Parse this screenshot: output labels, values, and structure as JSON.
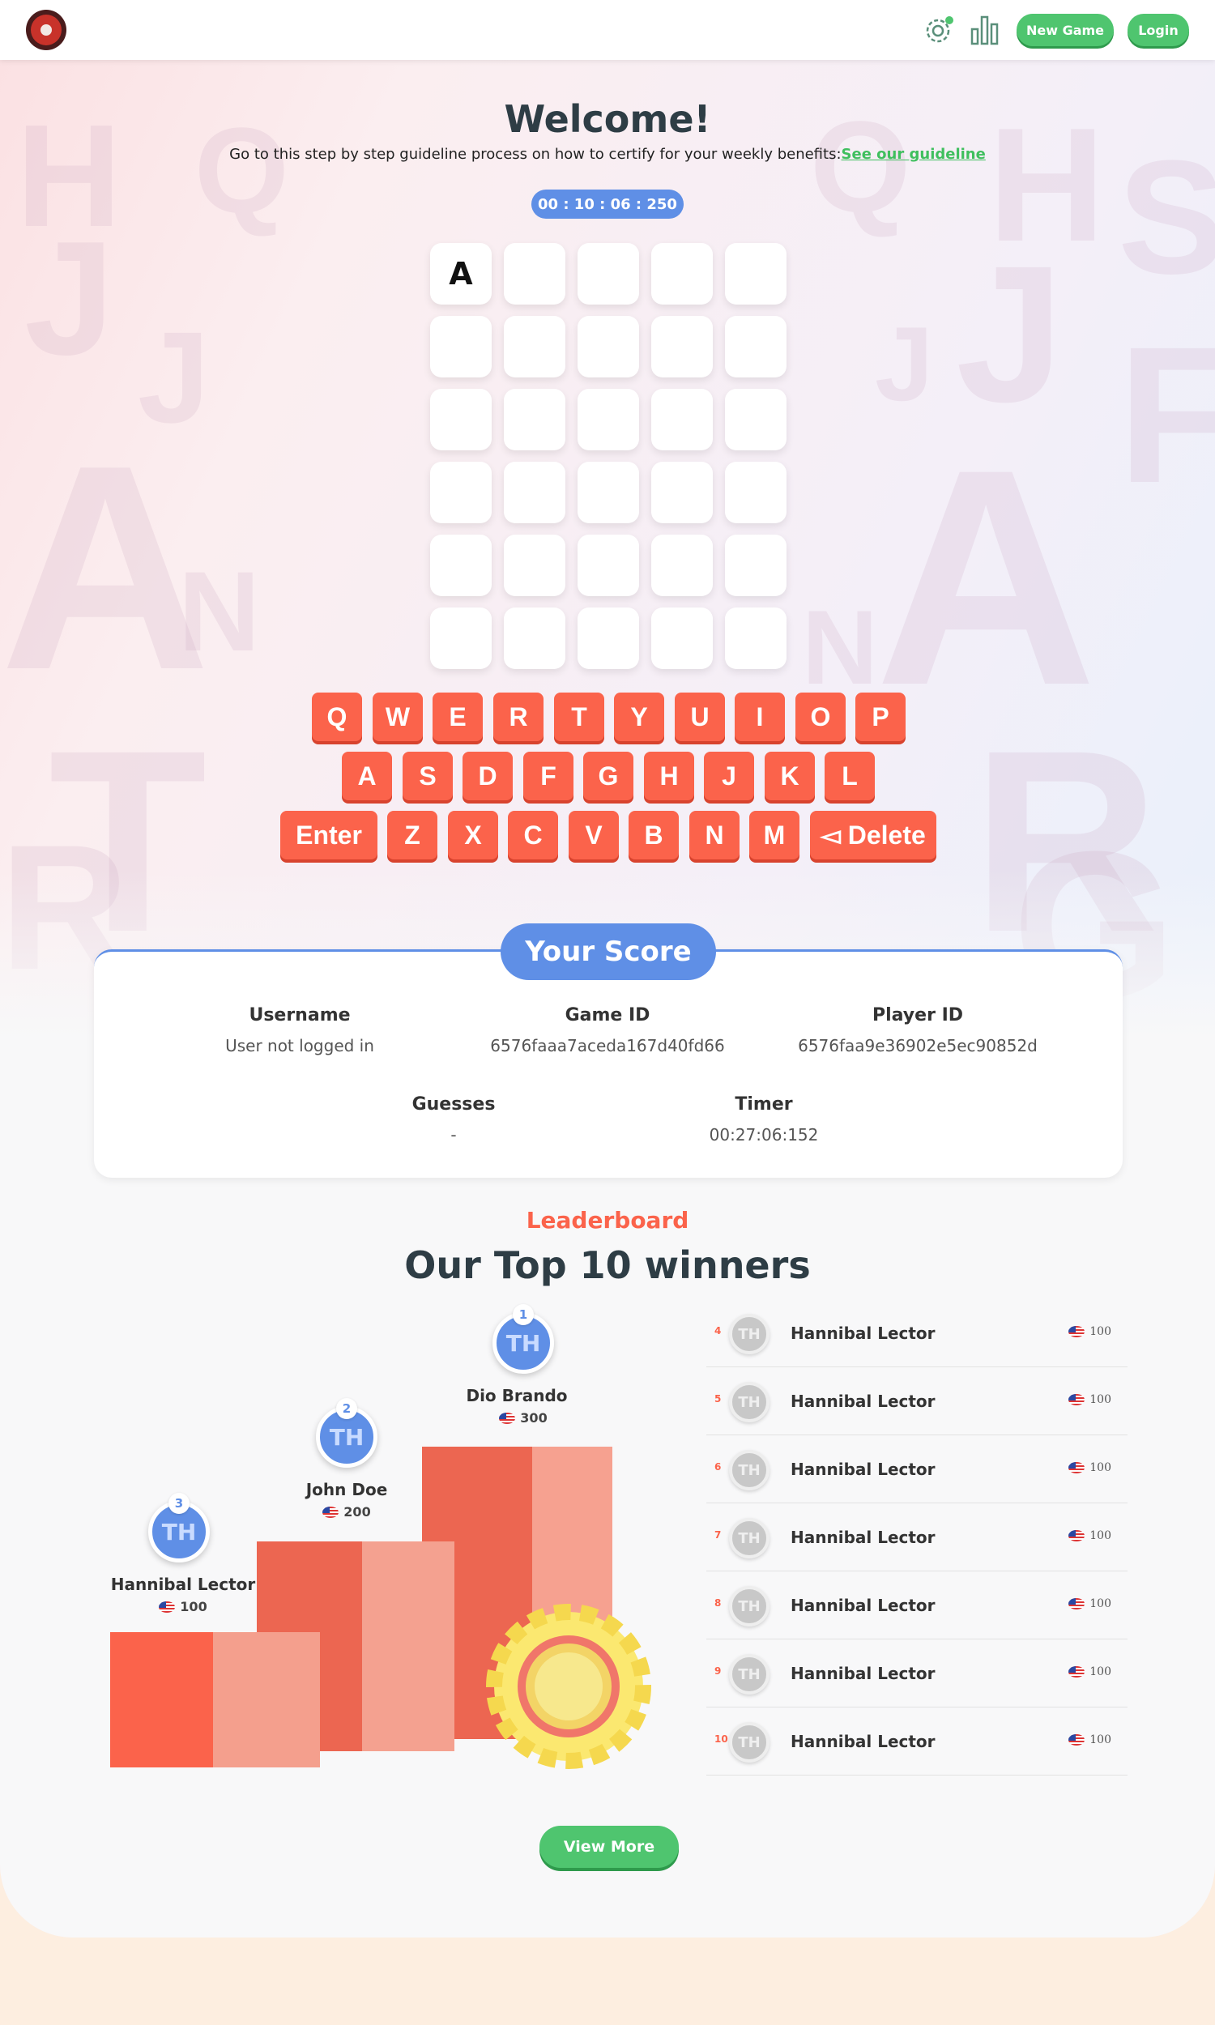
{
  "navbar": {
    "new_game": "New Game",
    "login": "Login"
  },
  "welcome": {
    "title": "Welcome!",
    "subtitle": "Go to this step by step guideline process on how to certify for your weekly benefits:",
    "guideline_link": "See our guideline",
    "timer": "00 : 10 : 06 : 250"
  },
  "board": {
    "rows": [
      [
        "A",
        "",
        "",
        "",
        ""
      ],
      [
        "",
        "",
        "",
        "",
        ""
      ],
      [
        "",
        "",
        "",
        "",
        ""
      ],
      [
        "",
        "",
        "",
        "",
        ""
      ],
      [
        "",
        "",
        "",
        "",
        ""
      ],
      [
        "",
        "",
        "",
        "",
        ""
      ]
    ]
  },
  "keyboard": {
    "row1": [
      "Q",
      "W",
      "E",
      "R",
      "T",
      "Y",
      "U",
      "I",
      "O",
      "P"
    ],
    "row2": [
      "A",
      "S",
      "D",
      "F",
      "G",
      "H",
      "J",
      "K",
      "L"
    ],
    "row3": [
      "Enter",
      "Z",
      "X",
      "C",
      "V",
      "B",
      "N",
      "M",
      "◅ Delete"
    ]
  },
  "score": {
    "title": "Your Score",
    "username_label": "Username",
    "username_value": "User not logged in",
    "game_id_label": "Game ID",
    "game_id_value": "6576faaa7aceda167d40fd66",
    "player_id_label": "Player ID",
    "player_id_value": "6576faa9e36902e5ec90852d",
    "guesses_label": "Guesses",
    "guesses_value": "-",
    "timer_label": "Timer",
    "timer_value": "00:27:06:152"
  },
  "leaderboard": {
    "kicker": "Leaderboard",
    "title": "Our Top 10 winners",
    "podium": [
      {
        "rank": "1",
        "initials": "TH",
        "name": "Dio Brando",
        "score": "300"
      },
      {
        "rank": "2",
        "initials": "TH",
        "name": "John Doe",
        "score": "200"
      },
      {
        "rank": "3",
        "initials": "TH",
        "name": "Hannibal Lector",
        "score": "100"
      }
    ],
    "list": [
      {
        "rank": "4",
        "initials": "TH",
        "name": "Hannibal Lector",
        "score": "100"
      },
      {
        "rank": "5",
        "initials": "TH",
        "name": "Hannibal Lector",
        "score": "100"
      },
      {
        "rank": "6",
        "initials": "TH",
        "name": "Hannibal Lector",
        "score": "100"
      },
      {
        "rank": "7",
        "initials": "TH",
        "name": "Hannibal Lector",
        "score": "100"
      },
      {
        "rank": "8",
        "initials": "TH",
        "name": "Hannibal Lector",
        "score": "100"
      },
      {
        "rank": "9",
        "initials": "TH",
        "name": "Hannibal Lector",
        "score": "100"
      },
      {
        "rank": "10",
        "initials": "TH",
        "name": "Hannibal Lector",
        "score": "100"
      }
    ],
    "view_more": "View More"
  },
  "colors": {
    "accent_blue": "#5f8fe6",
    "key_red": "#fb634b",
    "button_green": "#4fc56f",
    "title_dark": "#2e3d45"
  },
  "icons": {
    "settings": "gear-icon",
    "stats": "bar-chart-icon",
    "logo": "app-logo",
    "flag": "us-flag-icon"
  }
}
